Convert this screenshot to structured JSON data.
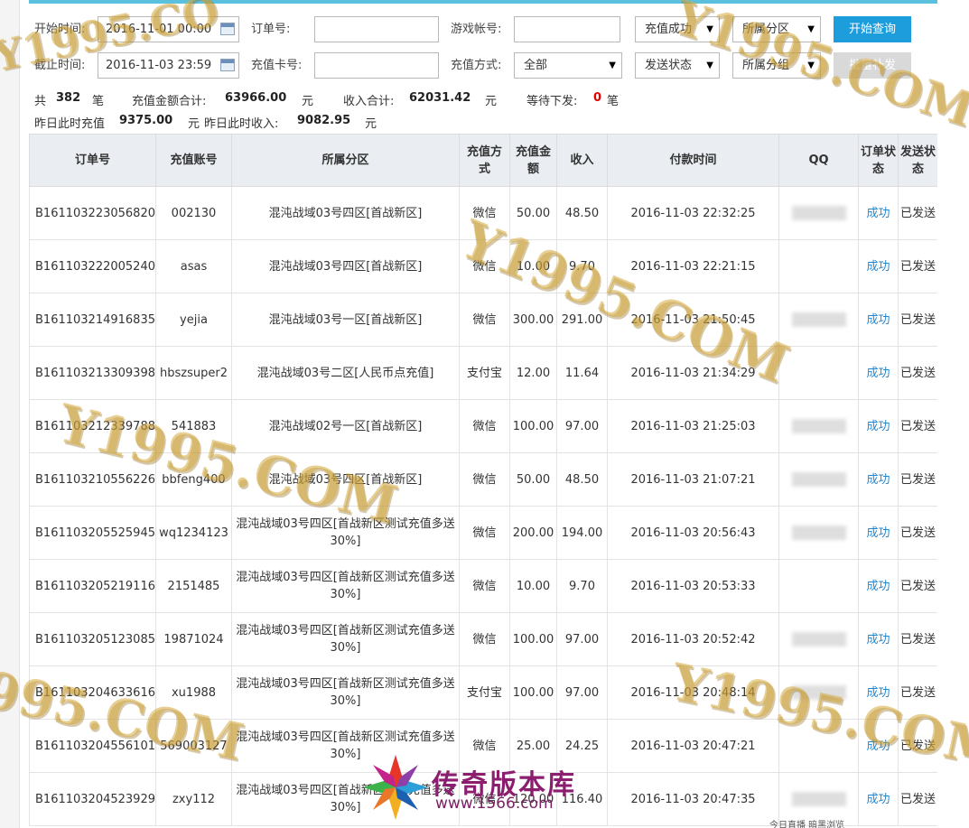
{
  "filters": {
    "start_time_label": "开始时间:",
    "start_time_value": "2016-11-01 00:00",
    "end_time_label": "截止时间:",
    "end_time_value": "2016-11-03 23:59",
    "order_no_label": "订单号:",
    "recharge_card_label": "充值卡号:",
    "game_account_label": "游戏帐号:",
    "pay_method_label": "充值方式:",
    "pay_method_value": "全部",
    "recharge_status_value": "充值成功",
    "send_status_value": "发送状态",
    "zone_value": "所属分区",
    "group_value": "所属分组",
    "search_button": "开始查询",
    "batch_button": "批量补发"
  },
  "summary": {
    "total_prefix": "共",
    "total_count": "382",
    "total_suffix": "笔",
    "recharge_total_label": "充值金额合计:",
    "recharge_total_value": "63966.00",
    "yuan1": "元",
    "income_total_label": "收入合计:",
    "income_total_value": "62031.42",
    "yuan2": "元",
    "pending_label": "等待下发:",
    "pending_value": "0",
    "pending_suffix": "笔",
    "yesterday_recharge_label": "昨日此时充值",
    "yesterday_recharge_value": "9375.00",
    "yuan3": "元",
    "yesterday_income_label": "昨日此时收入:",
    "yesterday_income_value": "9082.95",
    "yuan4": "元"
  },
  "table": {
    "headers": [
      "订单号",
      "充值账号",
      "所属分区",
      "充值方式",
      "充值金额",
      "收入",
      "付款时间",
      "QQ",
      "订单状态",
      "发送状态"
    ],
    "rows": [
      {
        "order": "B161103223056820",
        "account": "002130",
        "zone": "混沌战域03号四区[首战新区]",
        "method": "微信",
        "amount": "50.00",
        "income": "48.50",
        "time": "2016-11-03 22:32:25",
        "qq": true,
        "status": "成功",
        "send": "已发送"
      },
      {
        "order": "B161103222005240",
        "account": "asas",
        "zone": "混沌战域03号四区[首战新区]",
        "method": "微信",
        "amount": "10.00",
        "income": "9.70",
        "time": "2016-11-03 22:21:15",
        "qq": false,
        "status": "成功",
        "send": "已发送"
      },
      {
        "order": "B161103214916835",
        "account": "yejia",
        "zone": "混沌战域03号一区[首战新区]",
        "method": "微信",
        "amount": "300.00",
        "income": "291.00",
        "time": "2016-11-03 21:50:45",
        "qq": true,
        "status": "成功",
        "send": "已发送"
      },
      {
        "order": "B161103213309398",
        "account": "hbszsuper2",
        "zone": "混沌战域03号二区[人民币点充值]",
        "method": "支付宝",
        "amount": "12.00",
        "income": "11.64",
        "time": "2016-11-03 21:34:29",
        "qq": false,
        "status": "成功",
        "send": "已发送"
      },
      {
        "order": "B161103212339788",
        "account": "541883",
        "zone": "混沌战域02号一区[首战新区]",
        "method": "微信",
        "amount": "100.00",
        "income": "97.00",
        "time": "2016-11-03 21:25:03",
        "qq": true,
        "status": "成功",
        "send": "已发送"
      },
      {
        "order": "B161103210556226",
        "account": "bbfeng400",
        "zone": "混沌战域03号四区[首战新区]",
        "method": "微信",
        "amount": "50.00",
        "income": "48.50",
        "time": "2016-11-03 21:07:21",
        "qq": true,
        "status": "成功",
        "send": "已发送"
      },
      {
        "order": "B161103205525945",
        "account": "wq1234123",
        "zone": "混沌战域03号四区[首战新区测试充值多送30%]",
        "method": "微信",
        "amount": "200.00",
        "income": "194.00",
        "time": "2016-11-03 20:56:43",
        "qq": true,
        "status": "成功",
        "send": "已发送"
      },
      {
        "order": "B161103205219116",
        "account": "2151485",
        "zone": "混沌战域03号四区[首战新区测试充值多送30%]",
        "method": "微信",
        "amount": "10.00",
        "income": "9.70",
        "time": "2016-11-03 20:53:33",
        "qq": false,
        "status": "成功",
        "send": "已发送"
      },
      {
        "order": "B161103205123085",
        "account": "19871024",
        "zone": "混沌战域03号四区[首战新区测试充值多送30%]",
        "method": "微信",
        "amount": "100.00",
        "income": "97.00",
        "time": "2016-11-03 20:52:42",
        "qq": true,
        "status": "成功",
        "send": "已发送"
      },
      {
        "order": "B161103204633616",
        "account": "xu1988",
        "zone": "混沌战域03号四区[首战新区测试充值多送30%]",
        "method": "支付宝",
        "amount": "100.00",
        "income": "97.00",
        "time": "2016-11-03 20:48:14",
        "qq": true,
        "status": "成功",
        "send": "已发送"
      },
      {
        "order": "B161103204556101",
        "account": "569003127",
        "zone": "混沌战域03号四区[首战新区测试充值多送30%]",
        "method": "微信",
        "amount": "25.00",
        "income": "24.25",
        "time": "2016-11-03 20:47:21",
        "qq": false,
        "status": "成功",
        "send": "已发送"
      },
      {
        "order": "B161103204523929",
        "account": "zxy112",
        "zone": "混沌战域03号四区[首战新区测试充值多送30%]",
        "method": "微信",
        "amount": "120.00",
        "income": "116.40",
        "time": "2016-11-03 20:47:35",
        "qq": true,
        "status": "成功",
        "send": "已发送"
      }
    ]
  },
  "watermarks": {
    "wm1": "Y1995.CO",
    "wm2": "Y1995.COM",
    "wm3": "Y1995.COM",
    "wm4": "Y1995.COM",
    "wm5": "995.COM",
    "wm6": "Y1995.COM"
  },
  "logo": {
    "title": "传奇版本库",
    "url": "www.1566.com"
  },
  "bottom_tray": "今日直播   暗黑浏览"
}
